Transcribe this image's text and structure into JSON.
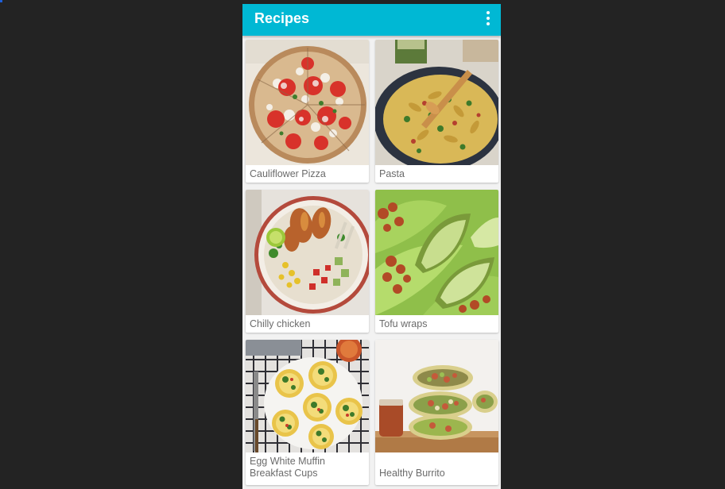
{
  "app": {
    "title": "Recipes",
    "overflow_icon": "more-vert-icon"
  },
  "colors": {
    "app_bar": "#00b8d4",
    "background": "#232323",
    "grid_background": "#f2f2f2",
    "caption_text": "#6b6b6b"
  },
  "recipes": [
    {
      "name": "Cauliflower Pizza",
      "image": "pizza-image"
    },
    {
      "name": "Pasta",
      "image": "pasta-image"
    },
    {
      "name": "Chilly chicken",
      "image": "chicken-bowl-image"
    },
    {
      "name": "Tofu wraps",
      "image": "lettuce-wrap-image"
    },
    {
      "name": "Egg White Muffin Breakfast Cups",
      "image": "egg-muffin-image"
    },
    {
      "name": "Healthy Burrito",
      "image": "burrito-image"
    }
  ]
}
